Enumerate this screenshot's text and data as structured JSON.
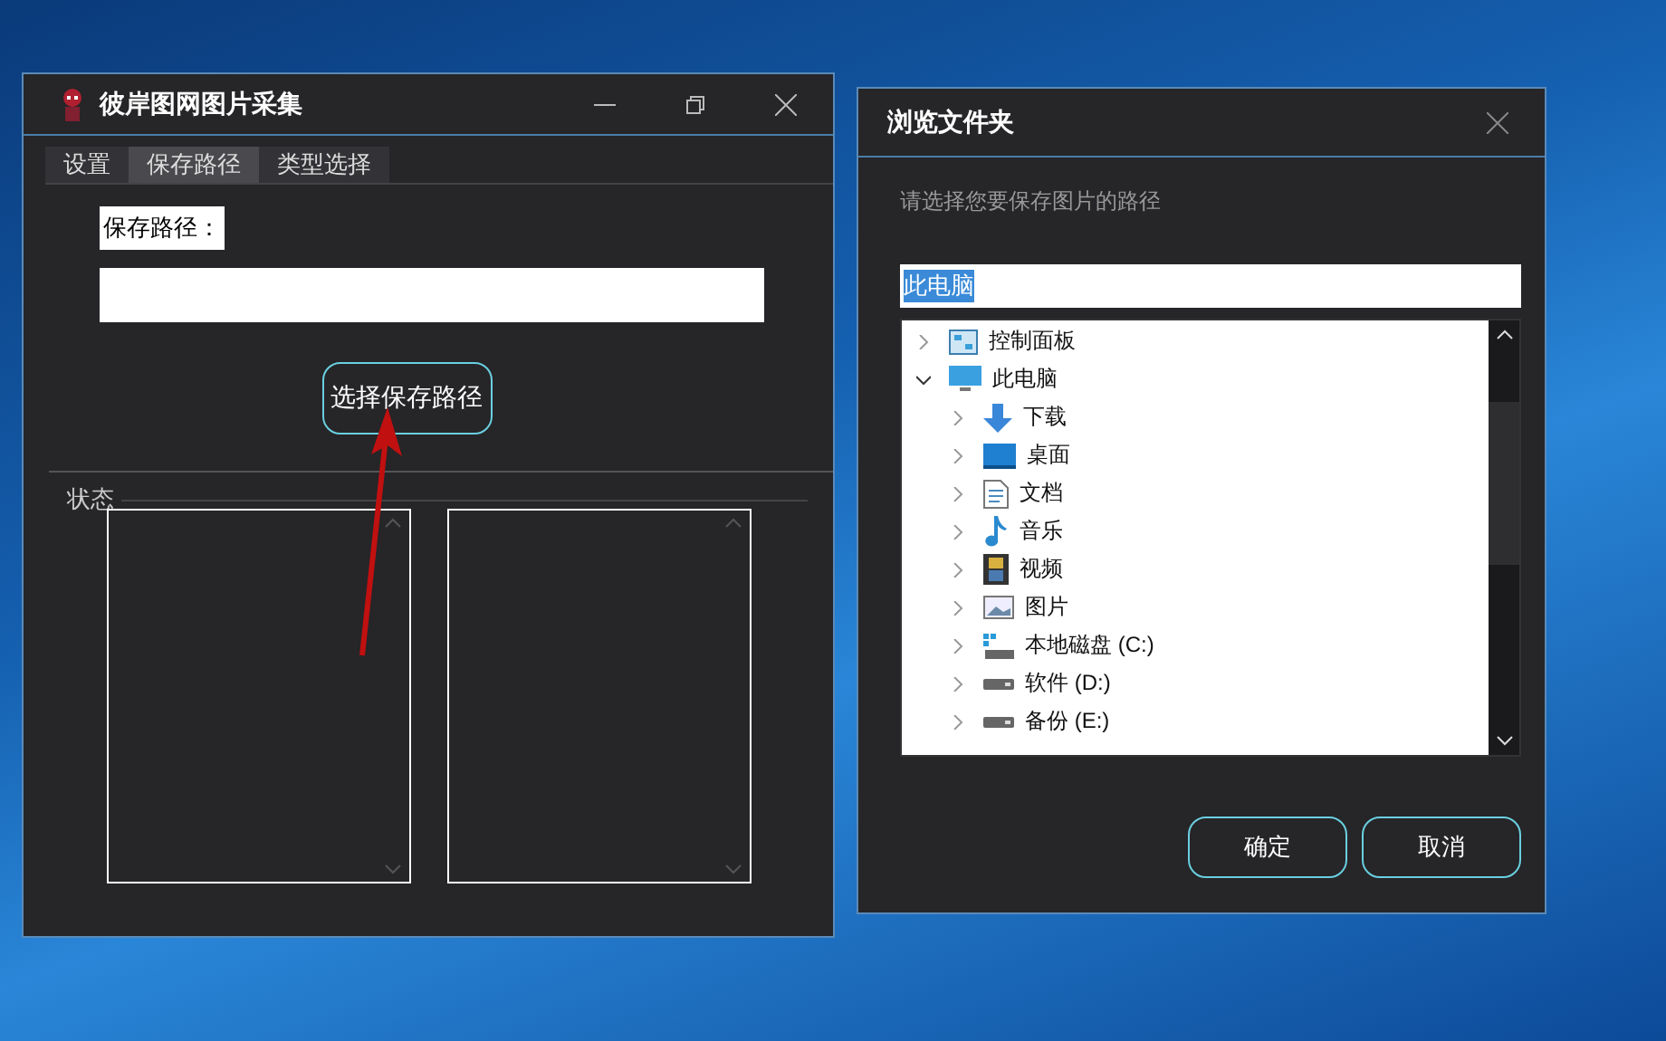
{
  "main_window": {
    "title": "彼岸图网图片采集",
    "tabs": [
      {
        "label": "设置",
        "selected": false
      },
      {
        "label": "保存路径",
        "selected": true
      },
      {
        "label": "类型选择",
        "selected": false
      }
    ],
    "save_path_label": "保存路径：",
    "choose_button": "选择保存路径",
    "status_label": "状态"
  },
  "dialog": {
    "title": "浏览文件夹",
    "prompt": "请选择您要保存图片的路径",
    "path_value": "此电脑",
    "tree": [
      {
        "label": "控制面板",
        "kind": "control-panel",
        "expanded": false
      },
      {
        "label": "此电脑",
        "kind": "computer",
        "expanded": true,
        "children": [
          {
            "label": "下载",
            "kind": "download",
            "expanded": false
          },
          {
            "label": "桌面",
            "kind": "desktop",
            "expanded": false
          },
          {
            "label": "文档",
            "kind": "document",
            "expanded": false
          },
          {
            "label": "音乐",
            "kind": "music",
            "expanded": false
          },
          {
            "label": "视频",
            "kind": "video",
            "expanded": false
          },
          {
            "label": "图片",
            "kind": "picture",
            "expanded": false
          },
          {
            "label": "本地磁盘 (C:)",
            "kind": "system-drive",
            "expanded": false
          },
          {
            "label": "软件 (D:)",
            "kind": "drive",
            "expanded": false
          },
          {
            "label": "备份 (E:)",
            "kind": "drive",
            "expanded": false
          }
        ]
      }
    ],
    "buttons": [
      "确定",
      "取消"
    ]
  }
}
